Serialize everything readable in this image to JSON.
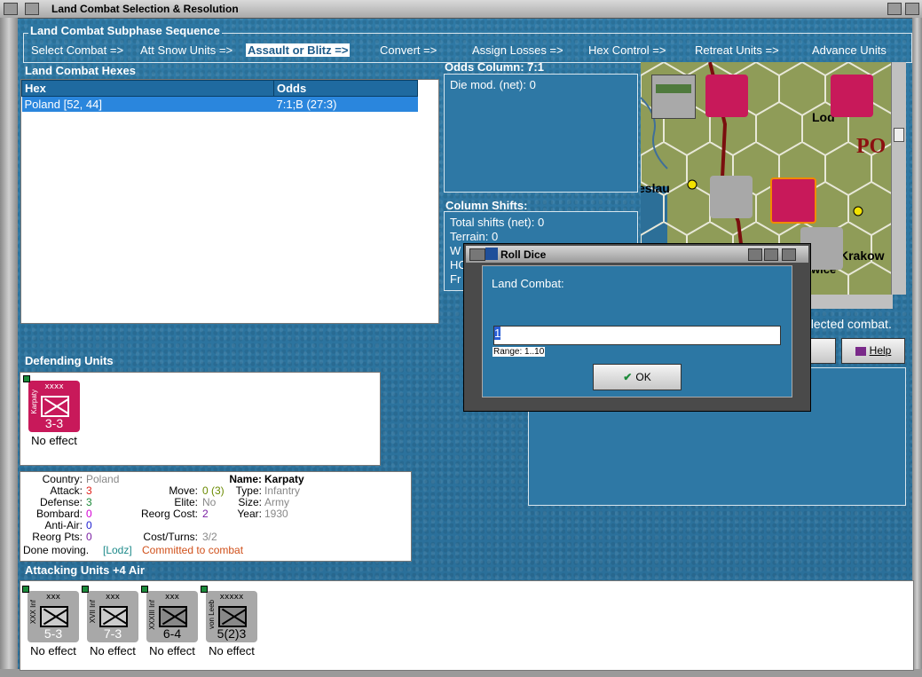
{
  "window": {
    "title": "Land Combat Selection & Resolution"
  },
  "phases": {
    "title": "Land Combat Subphase Sequence",
    "items": [
      "Select Combat =>",
      "Att Snow Units =>",
      "Assault or Blitz =>",
      "Convert =>",
      "Assign Losses =>",
      "Hex Control =>",
      "Retreat Units =>",
      "Advance Units"
    ],
    "selected": "Assault or Blitz =>"
  },
  "hexes": {
    "title": "Land Combat Hexes",
    "columns": [
      "Hex",
      "Odds"
    ],
    "rows": [
      {
        "hex": "Poland [52, 44]",
        "odds": "7:1;B (27:3)"
      }
    ]
  },
  "odds": {
    "title": "Odds Column: 7:1",
    "die_mod": "Die mod. (net): 0"
  },
  "shifts": {
    "title": "Column Shifts:",
    "lines": [
      "Total shifts (net): 0",
      "Terrain: 0",
      "W",
      "HC",
      "Fr"
    ]
  },
  "map": {
    "labels": {
      "lodz": "Lod",
      "pol": "PO",
      "breslau": "eslau",
      "krakow": "Krakow",
      "wice": "wice"
    }
  },
  "right_panel": {
    "status": "elected combat.",
    "rts_label": "rts",
    "help_label": "Help"
  },
  "defending": {
    "title": "Defending Units",
    "units": [
      {
        "name": "Karpaty",
        "size": "xxxx",
        "nation": "POL",
        "strength": "3-3",
        "result": "No effect"
      }
    ]
  },
  "info": {
    "country_label": "Country:",
    "country": "Poland",
    "attack_label": "Attack:",
    "attack": "3",
    "defense_label": "Defense:",
    "defense": "3",
    "bombard_label": "Bombard:",
    "bombard": "0",
    "antiair_label": "Anti-Air:",
    "antiair": "0",
    "reorg_pts_label": "Reorg Pts:",
    "reorg_pts": "0",
    "name_label": "Name:",
    "name": "Karpaty",
    "move_label": "Move:",
    "move": "0 (3)",
    "type_label": "Type:",
    "type": "Infantry",
    "elite_label": "Elite:",
    "elite": "No",
    "size_label": "Size:",
    "size": "Army",
    "reorg_cost_label": "Reorg Cost:",
    "reorg_cost": "2",
    "year_label": "Year:",
    "year": "1930",
    "cost_turns_label": "Cost/Turns:",
    "cost_turns": "3/2",
    "done_moving": "Done moving.",
    "location": "[Lodz]",
    "committed": "Committed to combat"
  },
  "attacking": {
    "title": "Attacking Units +4 Air",
    "units": [
      {
        "name": "XXX Inf",
        "size": "xxx",
        "strength": "5-3",
        "result": "No effect"
      },
      {
        "name": "XVII Inf",
        "size": "xxx",
        "strength": "7-3",
        "result": "No effect"
      },
      {
        "name": "XXXIII Inf",
        "size": "xxx",
        "strength": "6-4",
        "result": "No effect"
      },
      {
        "name": "von Leeb",
        "size": "xxxxx",
        "strength": "5(2)3",
        "result": "No effect"
      }
    ]
  },
  "dialog": {
    "title": "Roll Dice",
    "label": "Land Combat:",
    "value": "1",
    "range": "Range: 1..10",
    "ok": "OK"
  },
  "colors": {
    "attack": "#e0201a",
    "defense": "#1d8a3a",
    "bombard": "#d400d4",
    "antiair": "#2020d0",
    "reorg": "#7a1fa2",
    "move": "#6a8a00",
    "committed": "#d0501a",
    "location": "#1d8a8a"
  }
}
